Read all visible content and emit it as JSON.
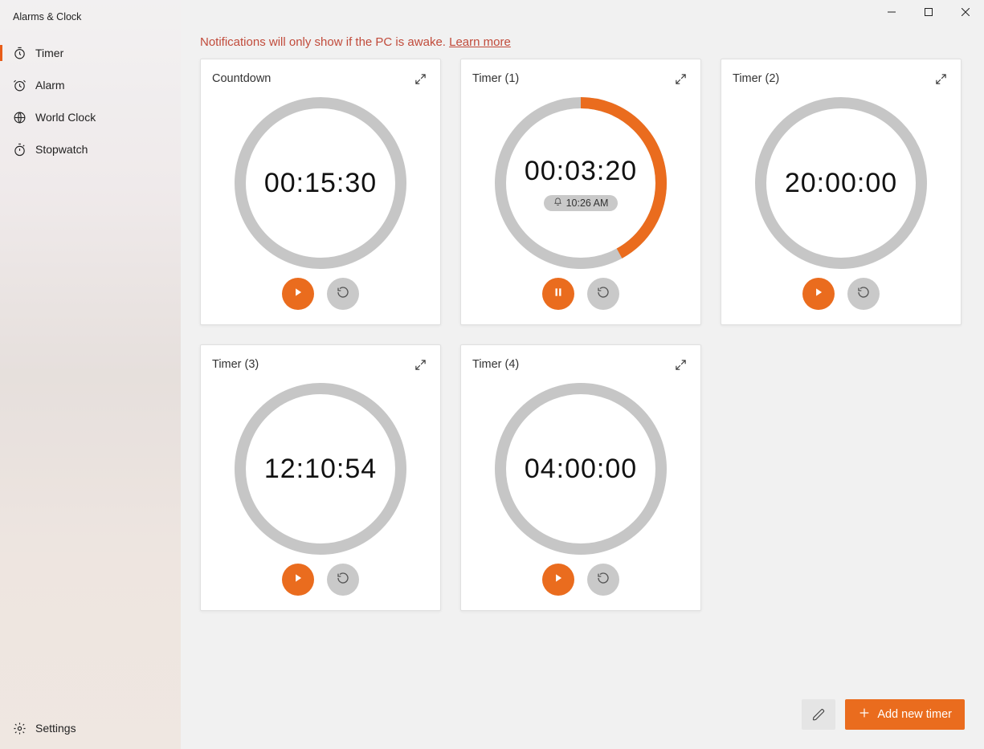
{
  "app": {
    "title": "Alarms & Clock"
  },
  "nav": {
    "items": [
      {
        "label": "Timer",
        "icon": "timer",
        "active": true
      },
      {
        "label": "Alarm",
        "icon": "alarm",
        "active": false
      },
      {
        "label": "World Clock",
        "icon": "world-clock",
        "active": false
      },
      {
        "label": "Stopwatch",
        "icon": "stopwatch",
        "active": false
      }
    ],
    "settings_label": "Settings"
  },
  "notice": {
    "text": "Notifications will only show if the PC is awake. ",
    "link_label": "Learn more"
  },
  "timers": [
    {
      "name": "Countdown",
      "time": "00:15:30",
      "progress": 0,
      "running": false,
      "chip": null
    },
    {
      "name": "Timer (1)",
      "time": "00:03:20",
      "progress": 0.42,
      "running": true,
      "chip": "10:26 AM"
    },
    {
      "name": "Timer (2)",
      "time": "20:00:00",
      "progress": 0,
      "running": false,
      "chip": null
    },
    {
      "name": "Timer (3)",
      "time": "12:10:54",
      "progress": 0,
      "running": false,
      "chip": null
    },
    {
      "name": "Timer (4)",
      "time": "04:00:00",
      "progress": 0,
      "running": false,
      "chip": null
    }
  ],
  "footer": {
    "add_label": "Add new timer"
  },
  "colors": {
    "accent": "#ea6c1e",
    "ring_bg": "#c6c6c6"
  }
}
